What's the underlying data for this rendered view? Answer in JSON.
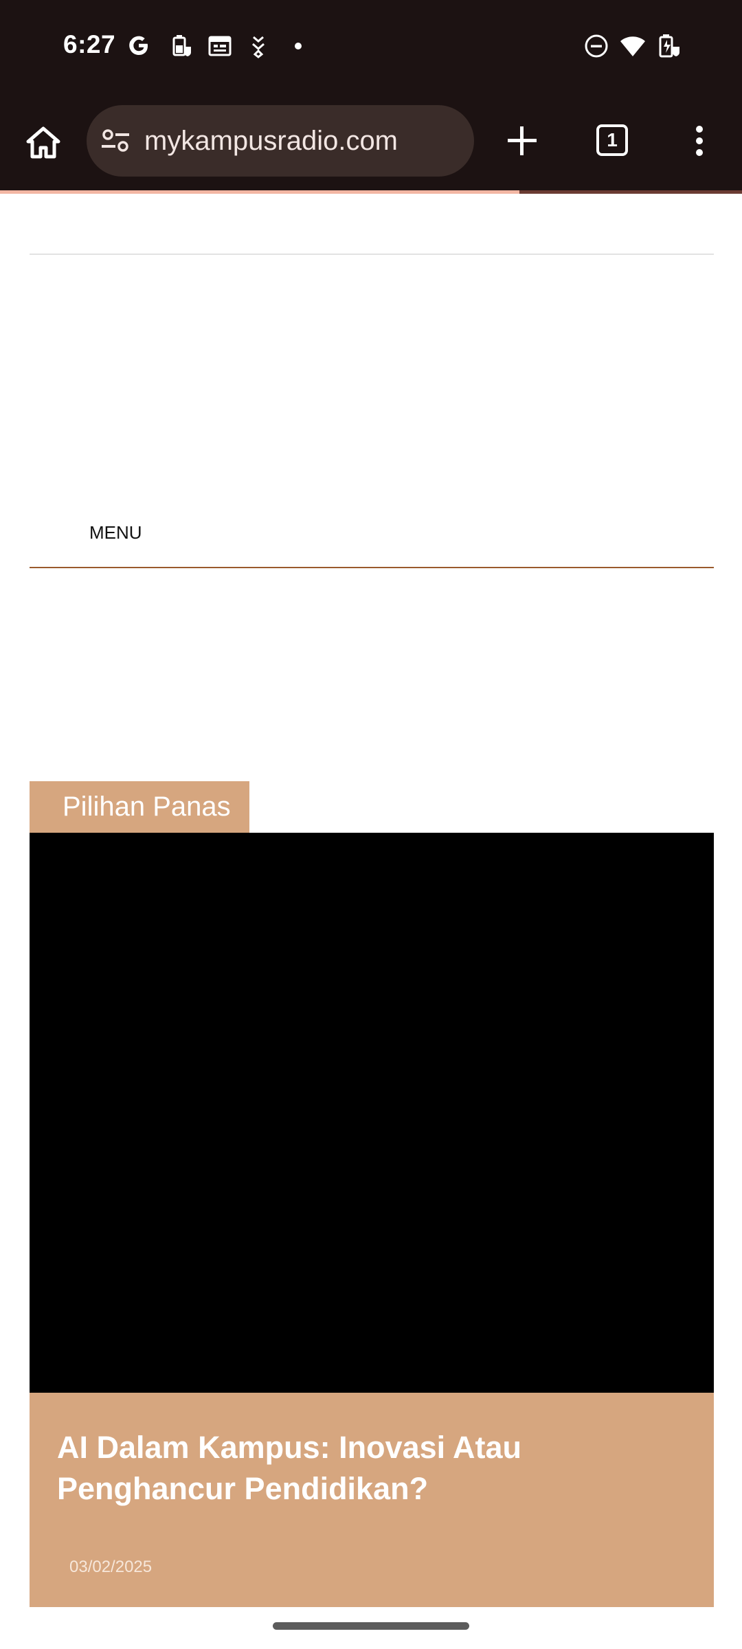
{
  "status_bar": {
    "time": "6:27",
    "icons_left": [
      "google-g-icon",
      "battery-saver-clipboard-icon",
      "calendar-icon",
      "wallet-icon",
      "dot-icon"
    ],
    "icons_right": [
      "do-not-disturb-icon",
      "wifi-icon",
      "battery-charging-icon"
    ]
  },
  "browser": {
    "url": "mykampusradio.com",
    "tab_count": "1",
    "load_progress_percent": 70,
    "colors": {
      "toolbar_bg": "#1c1212",
      "omnibox_bg": "#3a2c29",
      "progress": "#f2b6a3"
    }
  },
  "page": {
    "menu_label": "MENU",
    "section_tag": "Pilihan Panas",
    "featured": {
      "title": "AI Dalam Kampus: Inovasi Atau Penghancur Pendidikan?",
      "date": "03/02/2025"
    },
    "colors": {
      "accent": "#d6a67f",
      "menu_rule": "#9a5a2c"
    }
  }
}
